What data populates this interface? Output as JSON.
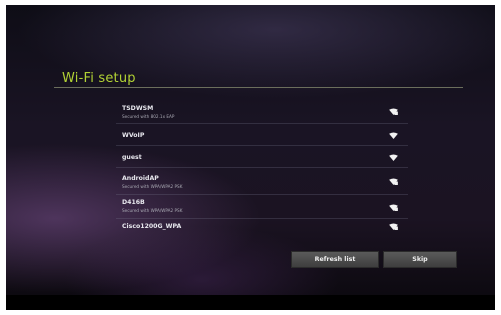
{
  "header": {
    "title": "Wi-Fi setup"
  },
  "networks": [
    {
      "name": "TSDWSM",
      "security": "Secured with 802.1x EAP",
      "icon": "wifi-secured-icon"
    },
    {
      "name": "WVoIP",
      "security": "",
      "icon": "wifi-open-icon"
    },
    {
      "name": "guest",
      "security": "",
      "icon": "wifi-open-icon"
    },
    {
      "name": "AndroidAP",
      "security": "Secured with WPA/WPA2 PSK",
      "icon": "wifi-secured-icon"
    },
    {
      "name": "D416B",
      "security": "Secured with WPA/WPA2 PSK",
      "icon": "wifi-secured-icon"
    },
    {
      "name": "Cisco1200G_WPA",
      "security": "",
      "icon": "wifi-secured-icon"
    }
  ],
  "buttons": {
    "refresh_label": "Refresh list",
    "skip_label": "Skip"
  },
  "colors": {
    "accent": "#b2d234",
    "button": "#4a4a4a"
  }
}
